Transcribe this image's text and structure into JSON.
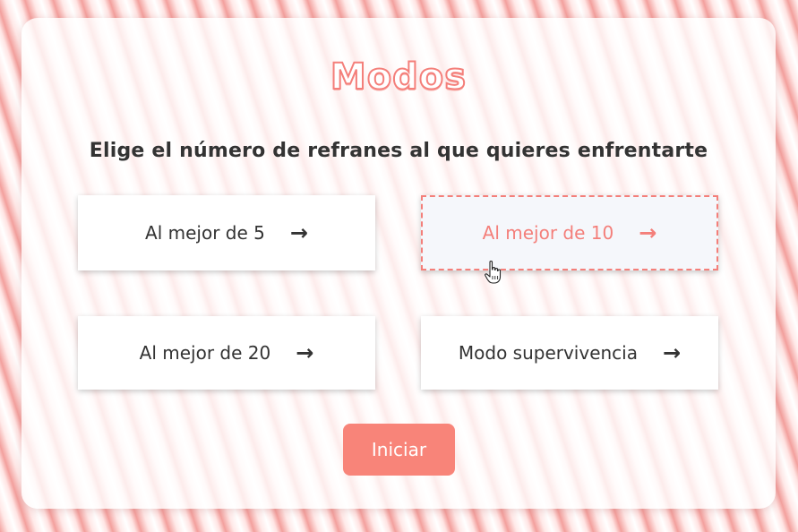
{
  "page": {
    "title": "Modos",
    "subtitle": "Elige el número de refranes al que quieres enfrentarte"
  },
  "modes": [
    {
      "label": "Al mejor de 5",
      "arrow": "→",
      "selected": false
    },
    {
      "label": "Al mejor de 10",
      "arrow": "→",
      "selected": true
    },
    {
      "label": "Al mejor de 20",
      "arrow": "→",
      "selected": false
    },
    {
      "label": "Modo supervivencia",
      "arrow": "→",
      "selected": false
    }
  ],
  "start_button": {
    "label": "Iniciar"
  },
  "colors": {
    "accent": "#f47f7a",
    "button": "#f88479",
    "text": "#333333"
  },
  "icons": {
    "arrow": "arrow-right-icon",
    "cursor": "hand-pointer-icon"
  }
}
